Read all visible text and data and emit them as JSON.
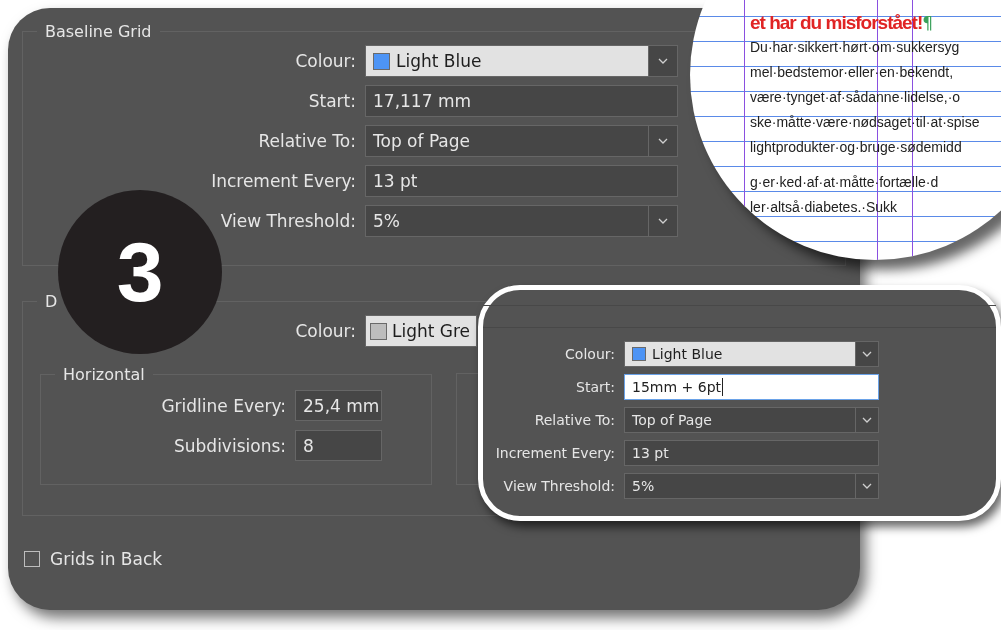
{
  "baseline_grid": {
    "title": "Baseline Grid",
    "rows": [
      {
        "label": "Colour:",
        "kind": "swatch-dropdown",
        "value": "Light Blue",
        "color": "#4d94f5"
      },
      {
        "label": "Start:",
        "kind": "field",
        "value": "17,117 mm"
      },
      {
        "label": "Relative To:",
        "kind": "dropdown",
        "value": "Top of Page"
      },
      {
        "label": "Increment Every:",
        "kind": "field",
        "value": "13 pt"
      },
      {
        "label": "View Threshold:",
        "kind": "dropdown",
        "value": "5%"
      }
    ]
  },
  "document_grid": {
    "title": "D",
    "colour": {
      "label": "Colour:",
      "value": "Light Gre",
      "color": "#bdbdbd"
    },
    "horizontal": {
      "title": "Horizontal",
      "rows": [
        {
          "label": "Gridline Every:",
          "value": "25,4 mm"
        },
        {
          "label": "Subdivisions:",
          "value": "8"
        }
      ]
    }
  },
  "grids_in_back": {
    "label": "Grids in Back",
    "checked": false
  },
  "badge": {
    "text": "3"
  },
  "magnifier": {
    "heading": "et har du misforstået!",
    "pilcrow": "¶",
    "paragraphs": [
      [
        "Du·har·sikkert·hørt·om·sukkersyg",
        "mel·bedstemor·eller·en·bekendt,",
        "være·tynget·af·sådanne·lidelse,·o",
        "ske·måtte·være·nødsaget·til·at·spise",
        "lightprodukter·og·bruge·sødemidd"
      ],
      [
        "g·er·ked·af·at·måtte·fortælle·d",
        "ler·altså·diabetes.·Sukk"
      ]
    ]
  },
  "inset": {
    "rows": [
      {
        "label": "Colour:",
        "kind": "swatch-dropdown",
        "value": "Light Blue",
        "color": "#4d94f5"
      },
      {
        "label": "Start:",
        "kind": "field",
        "value": "15mm + 6pt",
        "focused": true
      },
      {
        "label": "Relative To:",
        "kind": "dropdown",
        "value": "Top of Page"
      },
      {
        "label": "Increment Every:",
        "kind": "field",
        "value": "13 pt",
        "focused": false
      },
      {
        "label": "View Threshold:",
        "kind": "dropdown",
        "value": "5%"
      }
    ]
  }
}
